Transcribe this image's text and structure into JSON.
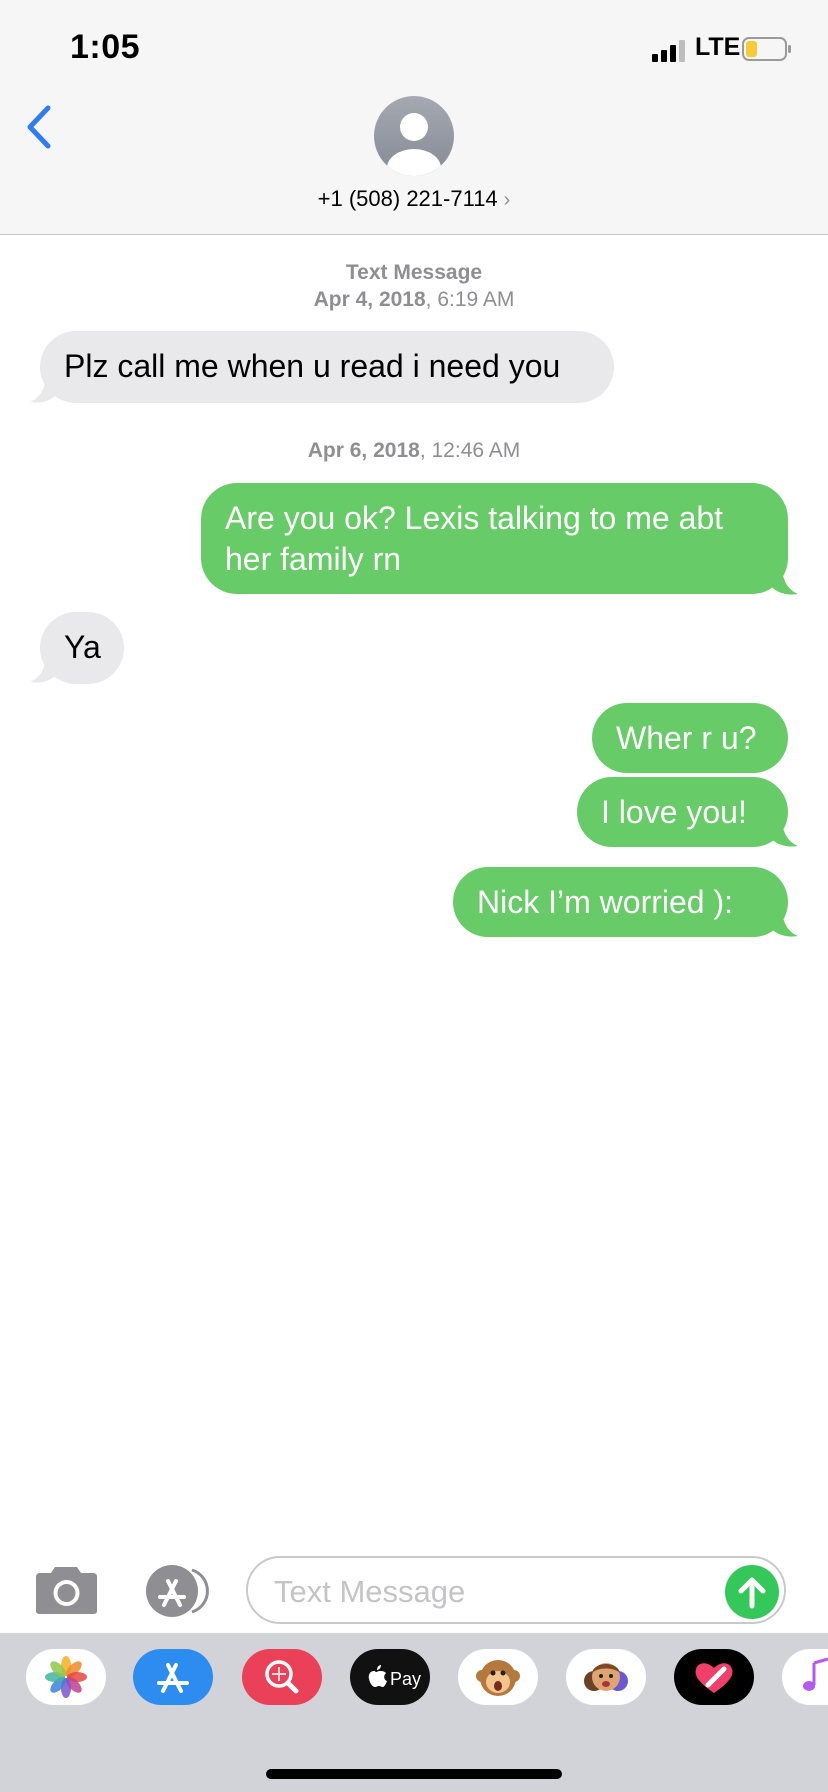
{
  "status_bar": {
    "time": "1:05",
    "network": "LTE"
  },
  "header": {
    "contact": "+1 (508) 221-7114",
    "chevron": "›"
  },
  "thread": [
    {
      "type": "stamp",
      "label": "Text Message",
      "date": "Apr 4, 2018",
      "time": ", 6:19 AM"
    },
    {
      "type": "incoming",
      "text": "Plz call me when u read i need you"
    },
    {
      "type": "stamp",
      "label": "",
      "date": "Apr 6, 2018",
      "time": ", 12:46 AM"
    },
    {
      "type": "outgoing",
      "text": "Are you ok? Lexis talking to me abt her family rn"
    },
    {
      "type": "incoming",
      "text": "Ya"
    },
    {
      "type": "outgoing",
      "text": "Wher r u?"
    },
    {
      "type": "outgoing",
      "text": "I love you!"
    },
    {
      "type": "outgoing",
      "text": "Nick I’m worried ):"
    }
  ],
  "input": {
    "placeholder": "Text Message"
  },
  "app_tray": [
    {
      "name": "photos-app-icon"
    },
    {
      "name": "app-store-app-icon"
    },
    {
      "name": "images-search-app-icon"
    },
    {
      "name": "apple-pay-app-icon",
      "label": "Pay"
    },
    {
      "name": "animoji-app-icon"
    },
    {
      "name": "memoji-app-icon"
    },
    {
      "name": "digital-touch-app-icon"
    },
    {
      "name": "music-app-icon"
    }
  ],
  "colors": {
    "outgoing": "#67cb67",
    "incoming": "#e9e9eb",
    "accent": "#2f7cf6",
    "send": "#34c759"
  }
}
